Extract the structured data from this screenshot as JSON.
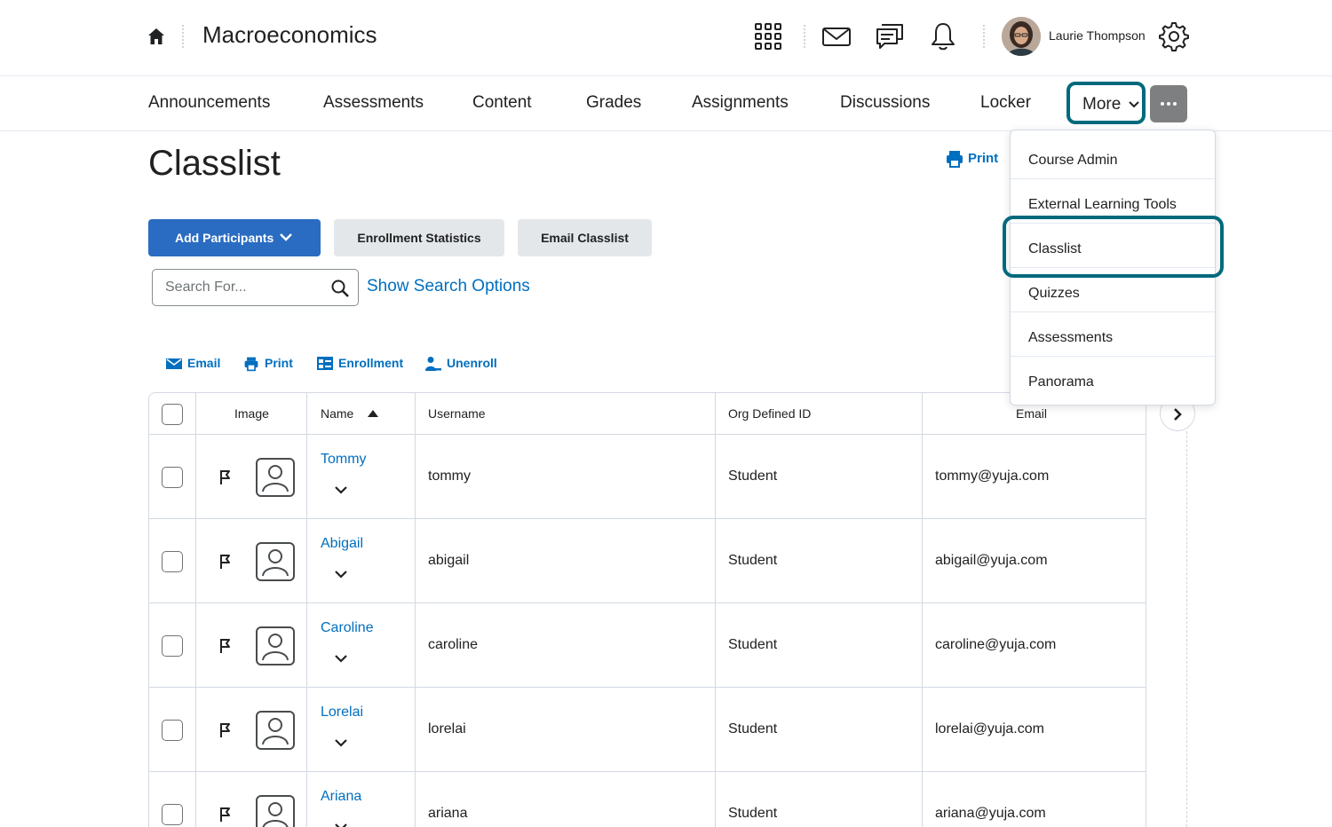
{
  "header": {
    "course_title": "Macroeconomics",
    "user_name": "Laurie Thompson",
    "icons": [
      "home-icon",
      "grid-icon",
      "mail-icon",
      "chat-icon",
      "bell-icon",
      "gear-icon"
    ]
  },
  "nav": {
    "items": [
      "Announcements",
      "Assessments",
      "Content",
      "Grades",
      "Assignments",
      "Discussions",
      "Locker"
    ],
    "more_label": "More"
  },
  "page": {
    "title": "Classlist",
    "print_label": "Print"
  },
  "buttons": {
    "add_participants": "Add Participants",
    "enrollment_statistics": "Enrollment Statistics",
    "email_classlist": "Email Classlist"
  },
  "search": {
    "placeholder": "Search For...",
    "value": "",
    "show_options": "Show Search Options"
  },
  "actions": {
    "email": "Email",
    "print": "Print",
    "enrollment": "Enrollment",
    "unenroll": "Unenroll"
  },
  "table": {
    "headers": {
      "image": "Image",
      "name": "Name",
      "username": "Username",
      "org_id": "Org Defined ID",
      "email": "Email"
    },
    "rows": [
      {
        "name": "Tommy",
        "username": "tommy",
        "org_id": "Student",
        "email": "tommy@yuja.com"
      },
      {
        "name": "Abigail",
        "username": "abigail",
        "org_id": "Student",
        "email": "abigail@yuja.com"
      },
      {
        "name": "Caroline",
        "username": "caroline",
        "org_id": "Student",
        "email": "caroline@yuja.com"
      },
      {
        "name": "Lorelai",
        "username": "lorelai",
        "org_id": "Student",
        "email": "lorelai@yuja.com"
      },
      {
        "name": "Ariana",
        "username": "ariana",
        "org_id": "Student",
        "email": "ariana@yuja.com"
      }
    ]
  },
  "dropdown": {
    "items": [
      "Course Admin",
      "External Learning Tools",
      "Classlist",
      "Quizzes",
      "Assessments",
      "Panorama"
    ],
    "highlighted": "Classlist"
  },
  "colors": {
    "link": "#006fbf",
    "primary_button": "#2a6cc2",
    "highlight_outline": "#006a7c"
  }
}
